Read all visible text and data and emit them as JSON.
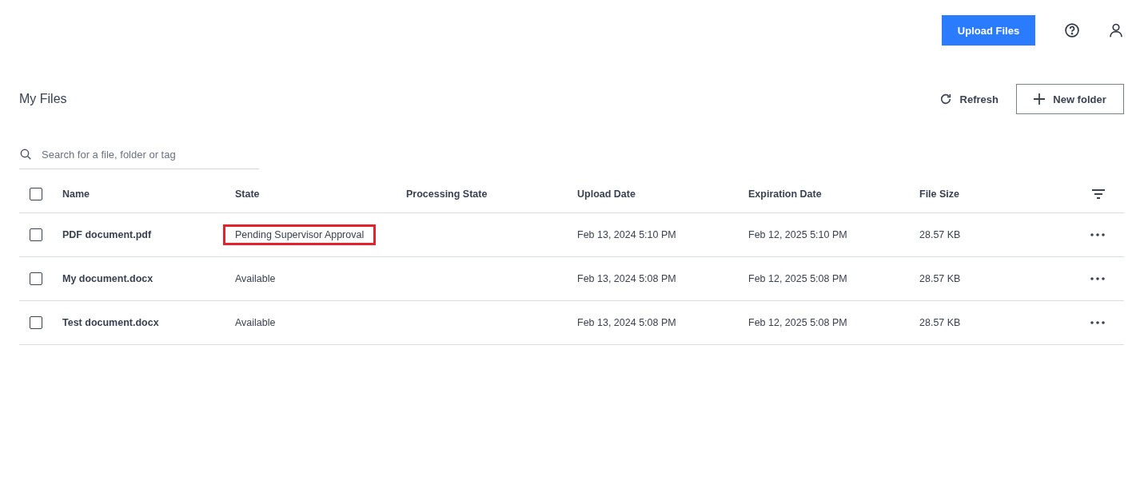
{
  "header": {
    "upload_button": "Upload Files"
  },
  "page": {
    "title": "My Files",
    "refresh": "Refresh",
    "new_folder": "New folder"
  },
  "search": {
    "placeholder": "Search for a file, folder or tag"
  },
  "table": {
    "select_all": {
      "checked": false
    },
    "columns": [
      "Name",
      "State",
      "Processing State",
      "Upload Date",
      "Expiration Date",
      "File Size"
    ],
    "rows": [
      {
        "checked": false,
        "name": "PDF document.pdf",
        "state": "Pending Supervisor Approval",
        "highlighted": true,
        "processing_state": "",
        "upload_date": "Feb 13, 2024 5:10 PM",
        "expiration_date": "Feb 12, 2025 5:10 PM",
        "file_size": "28.57 KB"
      },
      {
        "checked": false,
        "name": "My document.docx",
        "state": "Available",
        "highlighted": false,
        "processing_state": "",
        "upload_date": "Feb 13, 2024 5:08 PM",
        "expiration_date": "Feb 12, 2025 5:08 PM",
        "file_size": "28.57 KB"
      },
      {
        "checked": false,
        "name": "Test document.docx",
        "state": "Available",
        "highlighted": false,
        "processing_state": "",
        "upload_date": "Feb 13, 2024 5:08 PM",
        "expiration_date": "Feb 12, 2025 5:08 PM",
        "file_size": "28.57 KB"
      }
    ]
  }
}
